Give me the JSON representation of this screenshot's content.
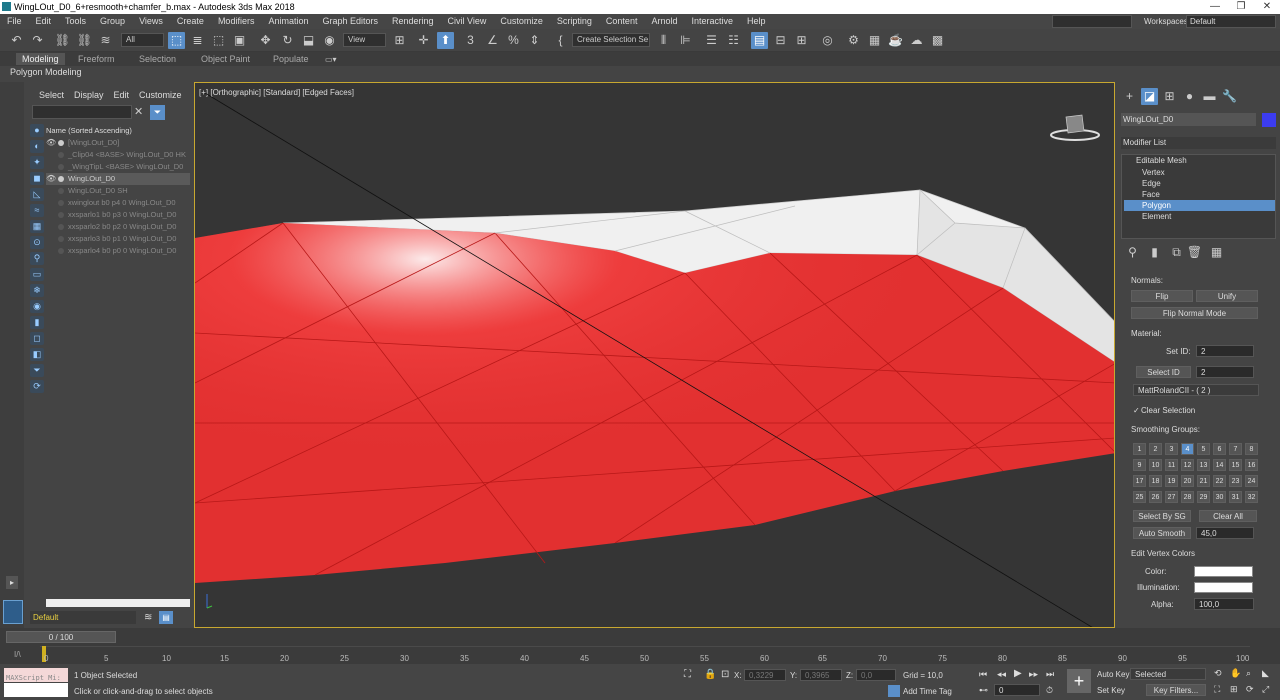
{
  "window": {
    "title": "WingLOut_D0_6+resmooth+chamfer_b.max - Autodesk 3ds Max 2018",
    "controls": [
      "—",
      "❐",
      "✕"
    ]
  },
  "menu": [
    "File",
    "Edit",
    "Tools",
    "Group",
    "Views",
    "Create",
    "Modifiers",
    "Animation",
    "Graph Editors",
    "Rendering",
    "Civil View",
    "Customize",
    "Scripting",
    "Content",
    "Arnold",
    "Interactive",
    "Help"
  ],
  "workspace": {
    "label": "Workspaces:",
    "value": "Default"
  },
  "toolbar": {
    "filter_value": "All",
    "view_value": "View",
    "selection_set_placeholder": "Create Selection Se"
  },
  "ribbon": {
    "tabs": [
      "Modeling",
      "Freeform",
      "Selection",
      "Object Paint",
      "Populate"
    ],
    "sub_label": "Polygon Modeling"
  },
  "scene_explorer": {
    "menu": [
      "Select",
      "Display",
      "Edit",
      "Customize"
    ],
    "column_header": "Name (Sorted Ascending)",
    "rows": [
      {
        "label": "[WingLOut_D0]",
        "visible": true,
        "selected": false
      },
      {
        "label": "_Clip04 <BASE> WingLOut_D0 HK",
        "visible": false,
        "selected": false
      },
      {
        "label": "_WingTipL <BASE> WingLOut_D0",
        "visible": false,
        "selected": false
      },
      {
        "label": "WingLOut_D0",
        "visible": true,
        "selected": true
      },
      {
        "label": "WingLOut_D0 SH",
        "visible": false,
        "selected": false
      },
      {
        "label": "xwinglout b0 p4 0 WingLOut_D0",
        "visible": false,
        "selected": false
      },
      {
        "label": "xxsparlo1 b0 p3 0 WingLOut_D0",
        "visible": false,
        "selected": false
      },
      {
        "label": "xxsparlo2 b0 p2 0 WingLOut_D0",
        "visible": false,
        "selected": false
      },
      {
        "label": "xxsparlo3 b0 p1 0 WingLOut_D0",
        "visible": false,
        "selected": false
      },
      {
        "label": "xxsparlo4 b0 p0 0 WingLOut_D0",
        "visible": false,
        "selected": false
      }
    ],
    "layer": "Default"
  },
  "viewport": {
    "label": "[+] [Orthographic] [Standard] [Edged Faces]"
  },
  "command_panel": {
    "object_name": "WingLOut_D0",
    "modifier_list": "Modifier List",
    "stack": [
      "Editable Mesh",
      "Vertex",
      "Edge",
      "Face",
      "Polygon",
      "Element"
    ],
    "stack_selected": "Polygon",
    "normals": {
      "title": "Normals:",
      "flip": "Flip",
      "unify": "Unify",
      "flip_normal_mode": "Flip Normal Mode"
    },
    "material": {
      "title": "Material:",
      "set_id_label": "Set ID:",
      "set_id_value": "2",
      "select_id": "Select ID",
      "select_id_value": "2",
      "material_name": "MattRolandCII - ( 2 )",
      "clear_selection": "Clear Selection"
    },
    "smoothing": {
      "title": "Smoothing Groups:",
      "groups": [
        "1",
        "2",
        "3",
        "4",
        "5",
        "6",
        "7",
        "8",
        "9",
        "10",
        "11",
        "12",
        "13",
        "14",
        "15",
        "16",
        "17",
        "18",
        "19",
        "20",
        "21",
        "22",
        "23",
        "24",
        "25",
        "26",
        "27",
        "28",
        "29",
        "30",
        "31",
        "32"
      ],
      "active": "4",
      "select_by_sg": "Select By SG",
      "clear_all": "Clear All",
      "auto_smooth": "Auto Smooth",
      "auto_smooth_value": "45,0"
    },
    "vertex_colors": {
      "title": "Edit Vertex Colors",
      "color": "Color:",
      "illumination": "Illumination:",
      "alpha": "Alpha:",
      "alpha_value": "100,0"
    }
  },
  "timeline": {
    "frame": "0 / 100",
    "ticks": [
      "0",
      "5",
      "10",
      "15",
      "20",
      "25",
      "30",
      "35",
      "40",
      "45",
      "50",
      "55",
      "60",
      "65",
      "70",
      "75",
      "80",
      "85",
      "90",
      "95",
      "100"
    ],
    "key_mode": "I/\\"
  },
  "status": {
    "maxscript": "MAXScript Mi:",
    "objects_selected": "1 Object Selected",
    "prompt": "Click or click-and-drag to select objects",
    "x_label": "X:",
    "x": "0,3229",
    "y_label": "Y:",
    "y": "0,3965",
    "z_label": "Z:",
    "z": "0,0",
    "grid": "Grid = 10,0",
    "add_time_tag": "Add Time Tag",
    "auto_key": "Auto Key",
    "set_key": "Set Key",
    "selected": "Selected",
    "key_filters": "Key Filters...",
    "frame_value": "0"
  }
}
